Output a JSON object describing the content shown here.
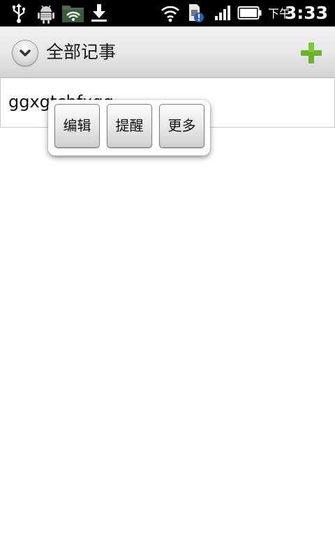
{
  "status_bar": {
    "time": "3:33",
    "ampm": "下午",
    "icons": [
      "usb-icon",
      "android-debug-icon",
      "wifi-folder-icon",
      "download-icon",
      "wifi-signal-icon",
      "sim-alert-icon",
      "cell-signal-icon",
      "battery-icon"
    ]
  },
  "title_bar": {
    "title": "全部记事",
    "dropdown_icon": "chevron-down-icon",
    "add_icon": "plus-icon",
    "add_color": "#6ab42a"
  },
  "notes": [
    {
      "text": "ggxgtchfxgg"
    }
  ],
  "popup": {
    "buttons": [
      "编辑",
      "提醒",
      "更多"
    ]
  }
}
